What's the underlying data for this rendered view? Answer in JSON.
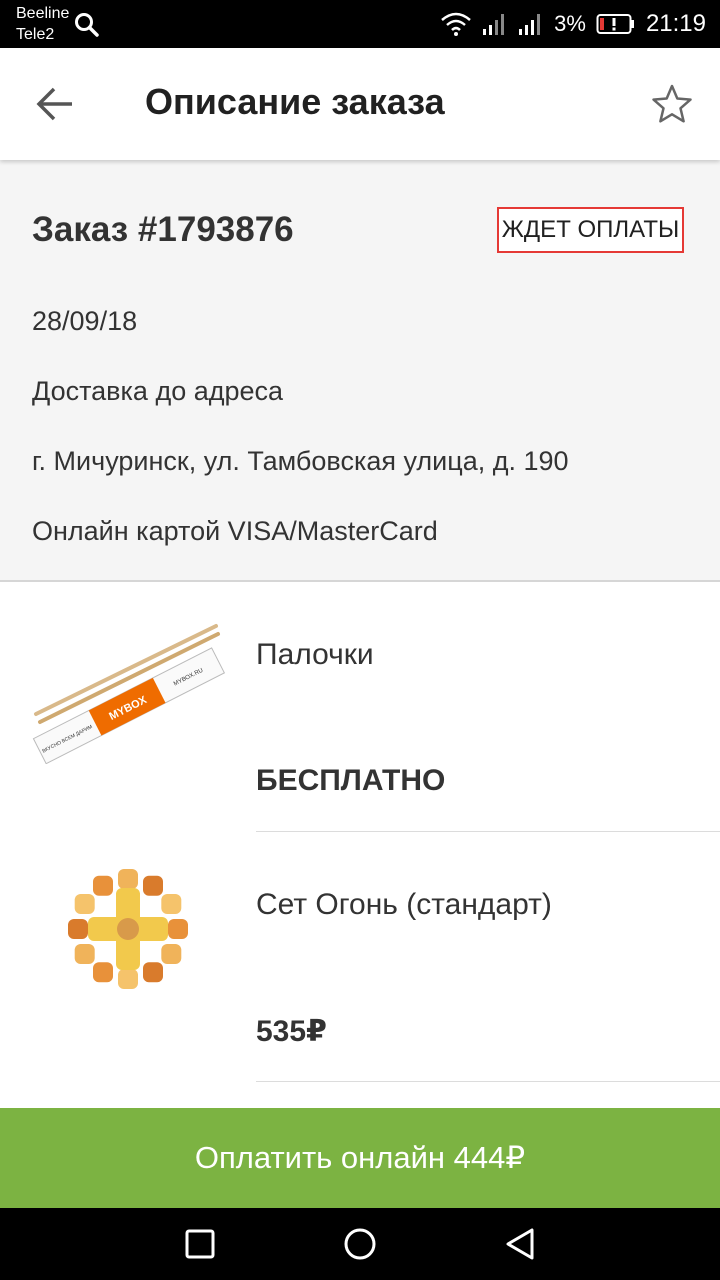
{
  "status_bar": {
    "carrier1": "Beeline",
    "carrier2": "Tele2",
    "battery_percent": "3%",
    "time": "21:19",
    "icons": [
      "search-icon",
      "wifi-icon",
      "signal-icon",
      "signal-icon",
      "battery-low-icon"
    ]
  },
  "app_bar": {
    "title": "Описание заказа",
    "back_icon": "arrow-back-icon",
    "favorite_icon": "star-outline-icon"
  },
  "order": {
    "number": "Заказ #1793876",
    "status": "ЖДЕТ ОПЛАТЫ",
    "date": "28/09/18",
    "delivery_type": "Доставка до адреса",
    "address": "г. Мичуринск, ул. Тамбовская улица, д. 190",
    "payment_method": "Онлайн картой VISA/MasterCard"
  },
  "items": [
    {
      "name": "Палочки",
      "price": "БЕСПЛАТНО",
      "image": "chopsticks",
      "image_texts": [
        "MYBOX",
        "MYBOX.RU",
        "ВКУСНО ВСЕМ ДАРИМ"
      ]
    },
    {
      "name": "Сет Огонь (стандарт)",
      "price": "535₽",
      "image": "sushi-set"
    }
  ],
  "pay_button": {
    "label": "Оплатить онлайн 444₽"
  },
  "colors": {
    "accent_green": "#7cb342",
    "status_border": "#e53935",
    "header_bg": "#f5f5f5"
  },
  "nav_bar": {
    "icons": [
      "recent-apps-icon",
      "home-icon",
      "back-icon"
    ]
  }
}
